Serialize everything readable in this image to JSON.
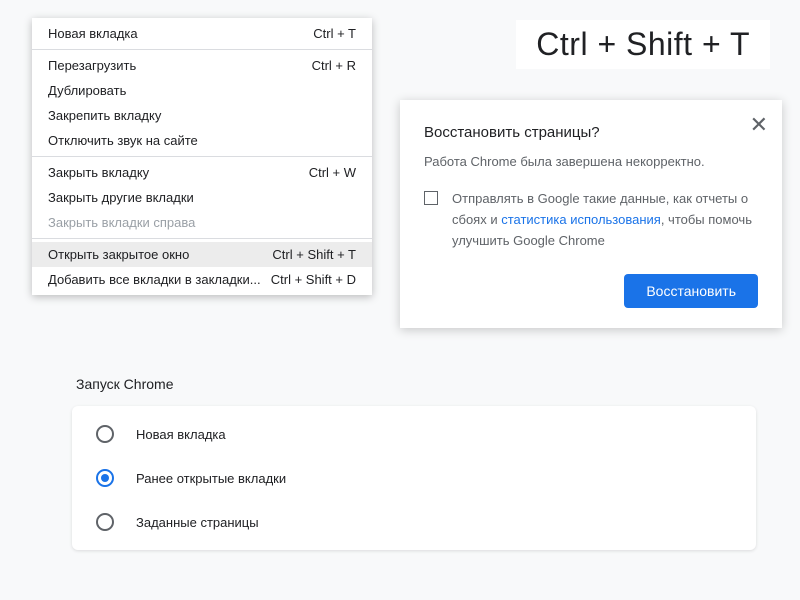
{
  "context_menu": {
    "items": [
      {
        "label": "Новая вкладка",
        "shortcut": "Ctrl + T"
      },
      {
        "separator": true
      },
      {
        "label": "Перезагрузить",
        "shortcut": "Ctrl + R"
      },
      {
        "label": "Дублировать",
        "shortcut": ""
      },
      {
        "label": "Закрепить вкладку",
        "shortcut": ""
      },
      {
        "label": "Отключить звук на сайте",
        "shortcut": ""
      },
      {
        "separator": true
      },
      {
        "label": "Закрыть вкладку",
        "shortcut": "Ctrl + W"
      },
      {
        "label": "Закрыть другие вкладки",
        "shortcut": ""
      },
      {
        "label": "Закрыть вкладки справа",
        "shortcut": "",
        "disabled": true
      },
      {
        "separator": true
      },
      {
        "label": "Открыть закрытое окно",
        "shortcut": "Ctrl + Shift + T",
        "highlighted": true
      },
      {
        "label": "Добавить все вкладки в закладки...",
        "shortcut": "Ctrl + Shift + D"
      }
    ]
  },
  "big_shortcut": "Ctrl + Shift + T",
  "restore_dialog": {
    "title": "Восстановить страницы?",
    "subtitle": "Работа Chrome была завершена некорректно.",
    "checkbox_text_1": "Отправлять в Google такие данные, как отчеты о сбоях и ",
    "checkbox_link": "статистика использования",
    "checkbox_text_2": ", чтобы помочь улучшить Google Chrome",
    "button": "Восстановить"
  },
  "startup": {
    "title": "Запуск Chrome",
    "options": [
      {
        "label": "Новая вкладка",
        "selected": false
      },
      {
        "label": "Ранее открытые вкладки",
        "selected": true
      },
      {
        "label": "Заданные страницы",
        "selected": false
      }
    ]
  }
}
